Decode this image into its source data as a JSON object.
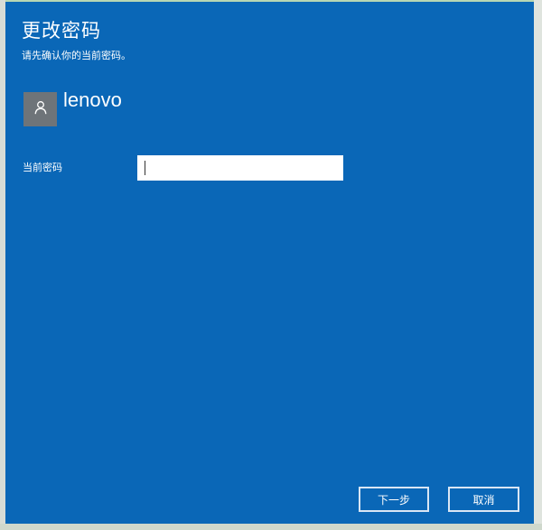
{
  "dialog": {
    "title": "更改密码",
    "subtitle": "请先确认你的当前密码。",
    "user": {
      "name": "lenovo",
      "avatar_icon": "user-icon"
    },
    "current_password": {
      "label": "当前密码",
      "value": ""
    },
    "buttons": {
      "next_label": "下一步",
      "cancel_label": "取消"
    },
    "colors": {
      "background": "#0a67b7",
      "avatar_bg": "#6e7479",
      "text": "#ffffff"
    }
  }
}
